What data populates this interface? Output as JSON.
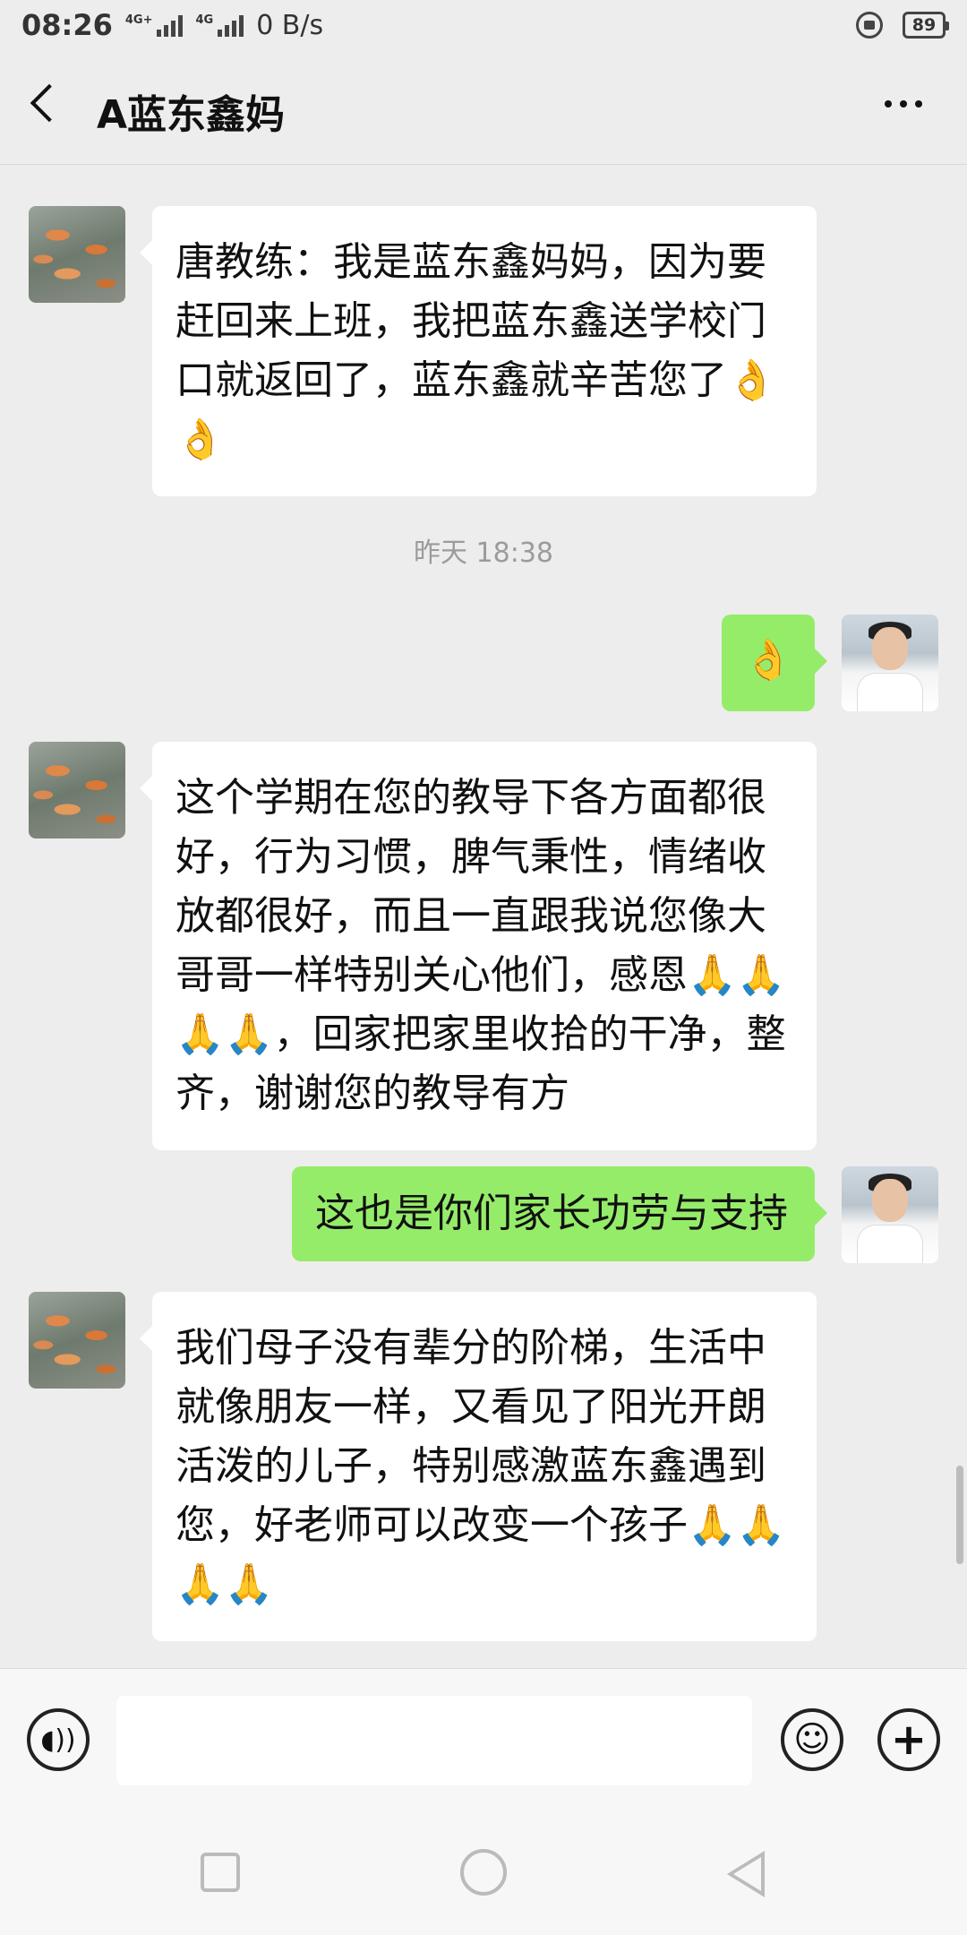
{
  "status_bar": {
    "time": "08:26",
    "network_1": "4G+",
    "network_2": "4G",
    "speed": "0 B/s",
    "battery": "89"
  },
  "header": {
    "title": "A蓝东鑫妈"
  },
  "messages": [
    {
      "side": "left",
      "text": "唐教练：我是蓝东鑫妈妈，因为要赶回来上班，我把蓝东鑫送学校门口就返回了，蓝东鑫就辛苦您了👌👌"
    },
    {
      "type": "timestamp",
      "text": "昨天 18:38"
    },
    {
      "side": "right",
      "text": "👌"
    },
    {
      "side": "left",
      "text": "这个学期在您的教导下各方面都很好，行为习惯，脾气秉性，情绪收放都很好，而且一直跟我说您像大哥哥一样特别关心他们，感恩🙏🙏🙏🙏，回家把家里收拾的干净，整齐，谢谢您的教导有方"
    },
    {
      "side": "right",
      "text": "这也是你们家长功劳与支持"
    },
    {
      "side": "left",
      "text": "我们母子没有辈分的阶梯，生活中就像朋友一样，又看见了阳光开朗活泼的儿子，特别感激蓝东鑫遇到您，好老师可以改变一个孩子🙏🙏🙏🙏"
    }
  ],
  "input_bar": {
    "voice_icon": "voice-icon",
    "emoji_icon": "emoji-icon",
    "plus_icon": "plus-icon"
  },
  "colors": {
    "background": "#ededed",
    "sent_bubble": "#95ec69",
    "received_bubble": "#ffffff"
  }
}
